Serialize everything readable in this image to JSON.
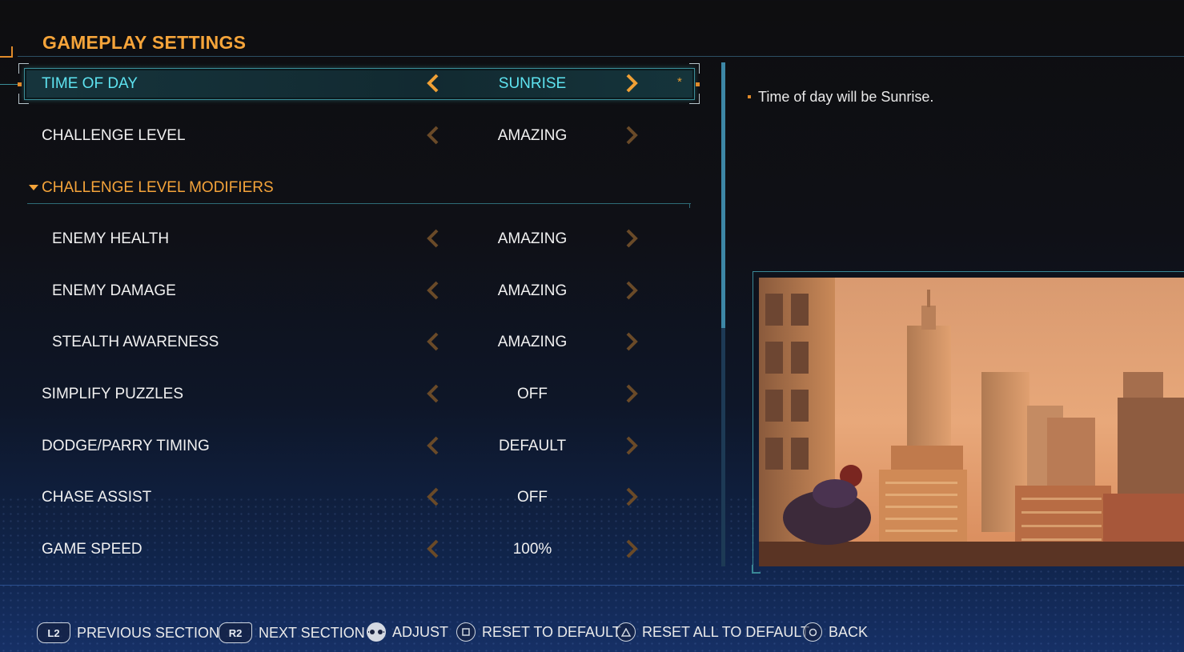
{
  "header": {
    "title": "GAMEPLAY SETTINGS"
  },
  "settings": {
    "time_of_day": {
      "label": "TIME OF DAY",
      "value": "SUNRISE"
    },
    "challenge_level": {
      "label": "CHALLENGE LEVEL",
      "value": "AMAZING"
    },
    "modifiers_section": {
      "label": "CHALLENGE LEVEL MODIFIERS"
    },
    "enemy_health": {
      "label": "ENEMY HEALTH",
      "value": "AMAZING"
    },
    "enemy_damage": {
      "label": "ENEMY DAMAGE",
      "value": "AMAZING"
    },
    "stealth_awareness": {
      "label": "STEALTH AWARENESS",
      "value": "AMAZING"
    },
    "simplify_puzzles": {
      "label": "SIMPLIFY PUZZLES",
      "value": "OFF"
    },
    "dodge_parry_timing": {
      "label": "DODGE/PARRY TIMING",
      "value": "DEFAULT"
    },
    "chase_assist": {
      "label": "CHASE ASSIST",
      "value": "OFF"
    },
    "game_speed": {
      "label": "GAME SPEED",
      "value": "100%"
    }
  },
  "selected": {
    "modified_marker": "*"
  },
  "description": {
    "text": "Time of day will be Sunrise."
  },
  "footer": {
    "l2_key": "L2",
    "previous_section": "PREVIOUS SECTION",
    "r2_key": "R2",
    "next_section": "NEXT SECTION",
    "adjust": "ADJUST",
    "reset_to_default": "RESET TO DEFAULT",
    "reset_all_to_default": "RESET ALL TO DEFAULT",
    "back": "BACK"
  },
  "colors": {
    "accent_orange": "#f5a43a",
    "selected_cyan": "#5ee3f0",
    "arrow_dim": "#6a4a28",
    "arrow_active": "#f0a035"
  },
  "icons": {
    "arrow_left": "chevron-left-icon",
    "arrow_right": "chevron-right-icon",
    "adjust": "left-stick-icon",
    "reset": "square-button-icon",
    "reset_all": "triangle-button-icon",
    "back": "circle-button-icon"
  }
}
